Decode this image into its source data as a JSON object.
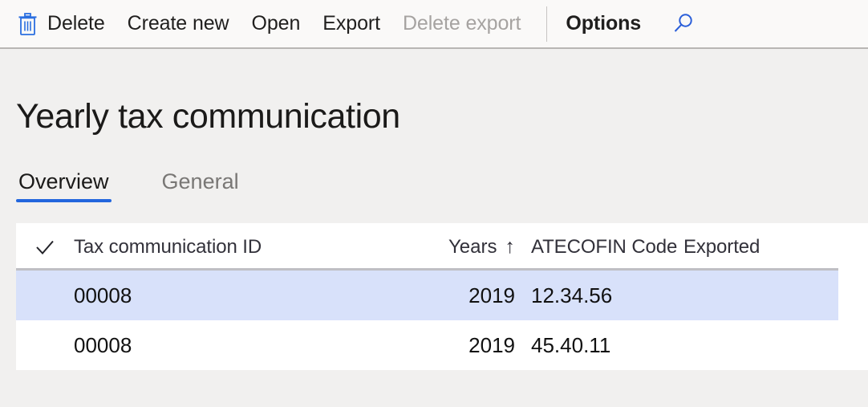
{
  "toolbar": {
    "items": [
      {
        "label": "Delete",
        "icon": "trash-icon",
        "disabled": false,
        "strong": false
      },
      {
        "label": "Create new",
        "icon": null,
        "disabled": false,
        "strong": false
      },
      {
        "label": "Open",
        "icon": null,
        "disabled": false,
        "strong": false
      },
      {
        "label": "Export",
        "icon": null,
        "disabled": false,
        "strong": false
      },
      {
        "label": "Delete export",
        "icon": null,
        "disabled": true,
        "strong": false
      },
      {
        "label": "Options",
        "icon": null,
        "disabled": false,
        "strong": true
      }
    ],
    "delete_label": "Delete",
    "create_new_label": "Create new",
    "open_label": "Open",
    "export_label": "Export",
    "delete_export_label": "Delete export",
    "options_label": "Options",
    "search_icon": "search-icon",
    "trash_icon": "trash-icon",
    "accent_color": "#2266dd"
  },
  "page": {
    "title": "Yearly tax communication"
  },
  "tabs": [
    {
      "label": "Overview",
      "active": true
    },
    {
      "label": "General",
      "active": false
    }
  ],
  "grid": {
    "select_all_icon": "checkmark-icon",
    "columns": [
      {
        "label": "Tax communication ID",
        "sort": null
      },
      {
        "label": "Years",
        "sort": "ascending",
        "sort_glyph": "↑"
      },
      {
        "label": "ATECOFIN Code",
        "sort": null
      },
      {
        "label": "Exported",
        "sort": null
      }
    ],
    "col_id_label": "Tax communication ID",
    "col_years_label": "Years",
    "col_years_sort_glyph": "↑",
    "col_ateco_label": "ATECOFIN Code",
    "col_exported_label": "Exported",
    "rows": [
      {
        "id": "00008",
        "years": "2019",
        "ateco": "12.34.56",
        "exported": "",
        "selected": true
      },
      {
        "id": "00008",
        "years": "2019",
        "ateco": "45.40.11",
        "exported": "",
        "selected": false
      }
    ],
    "row0": {
      "id": "00008",
      "years": "2019",
      "ateco": "12.34.56",
      "exported": ""
    },
    "row1": {
      "id": "00008",
      "years": "2019",
      "ateco": "45.40.11",
      "exported": ""
    },
    "selected_row_color": "#d8e1fa"
  }
}
